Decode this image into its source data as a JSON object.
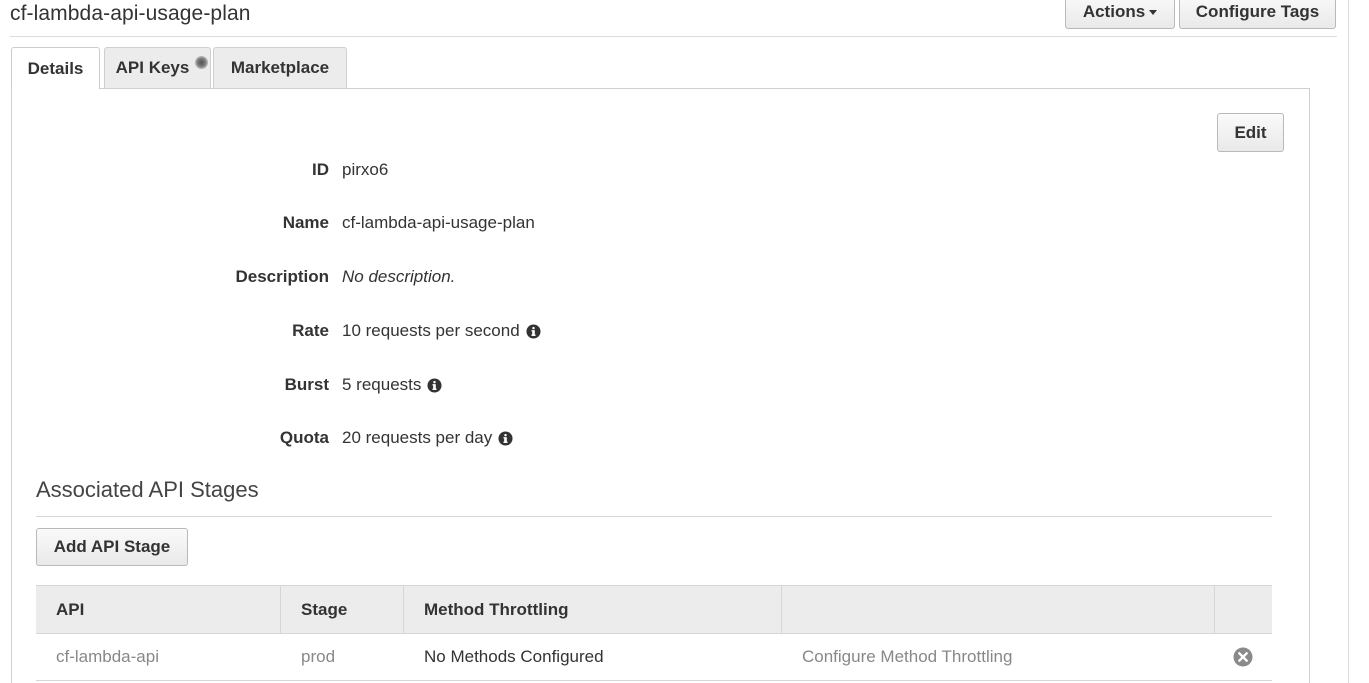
{
  "header": {
    "title": "cf-lambda-api-usage-plan",
    "actions_label": "Actions",
    "configure_tags_label": "Configure Tags"
  },
  "tabs": [
    {
      "label": "Details",
      "active": true
    },
    {
      "label": "API Keys",
      "active": false
    },
    {
      "label": "Marketplace",
      "active": false
    }
  ],
  "details": {
    "edit_label": "Edit",
    "fields": [
      {
        "label": "ID",
        "value": "pirxo6"
      },
      {
        "label": "Name",
        "value": "cf-lambda-api-usage-plan"
      },
      {
        "label": "Description",
        "value": "No description."
      },
      {
        "label": "Rate",
        "value": "10 requests per second"
      },
      {
        "label": "Burst",
        "value": "5 requests"
      },
      {
        "label": "Quota",
        "value": "20 requests per day"
      }
    ]
  },
  "stages": {
    "title": "Associated API Stages",
    "add_label": "Add API Stage",
    "columns": [
      "API",
      "Stage",
      "Method Throttling",
      "",
      ""
    ],
    "rows": [
      {
        "api": "cf-lambda-api",
        "stage": "prod",
        "method_throttling": "No Methods Configured",
        "action": "Configure Method Throttling"
      }
    ]
  },
  "icons": {
    "info": "info-circle-icon",
    "remove": "remove-circle-icon",
    "caret": "caret-down-icon"
  }
}
